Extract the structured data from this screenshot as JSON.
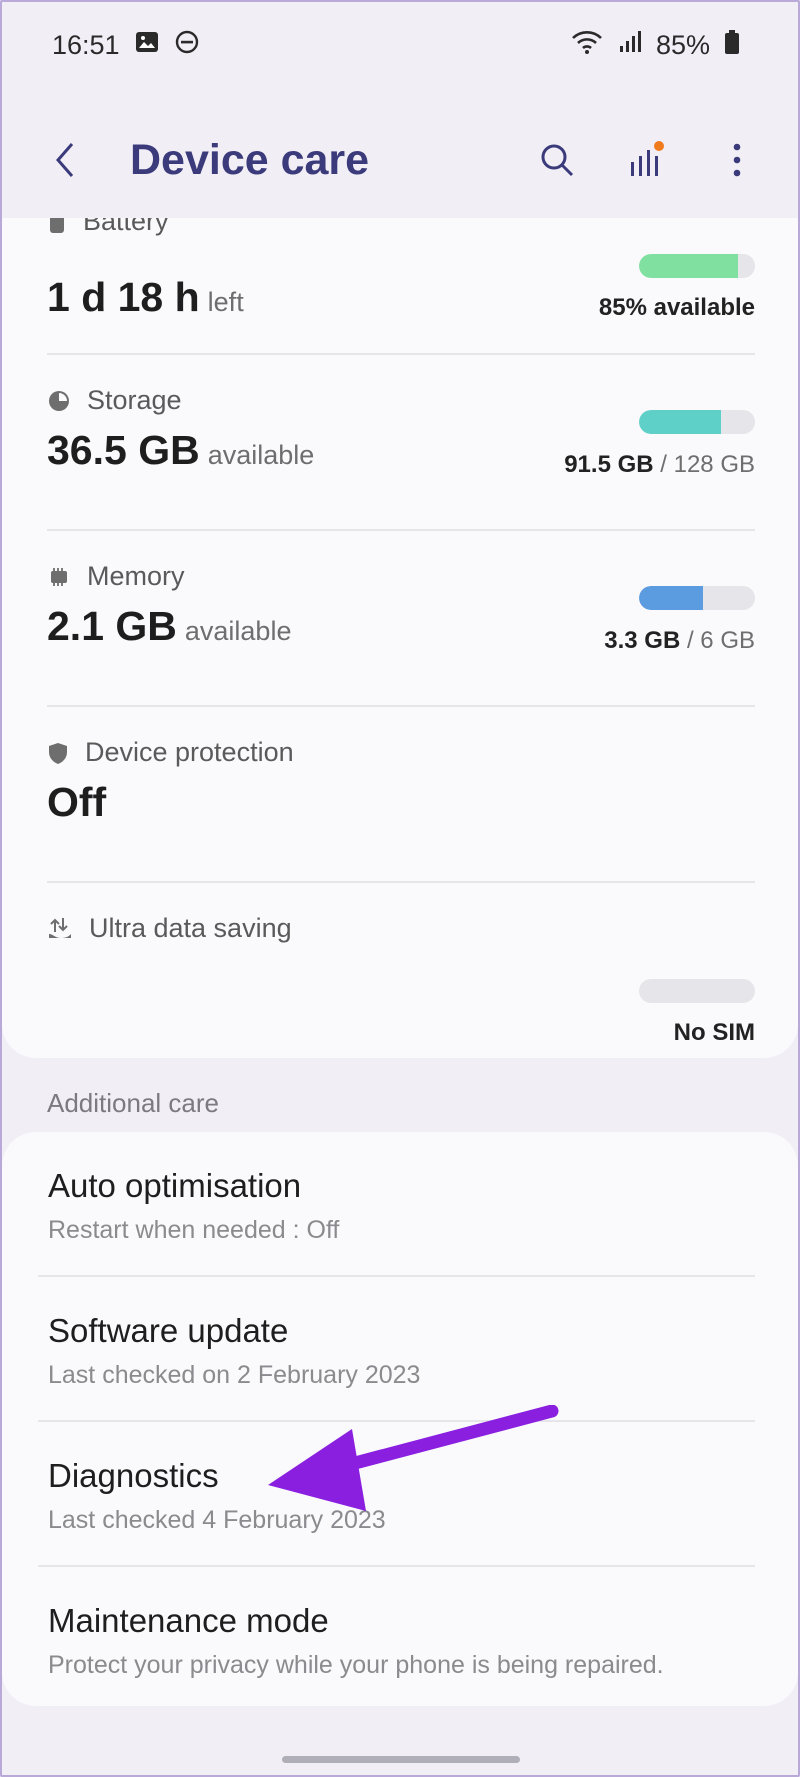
{
  "status_bar": {
    "time": "16:51",
    "battery": "85%"
  },
  "app_bar": {
    "title": "Device care"
  },
  "stats": {
    "battery": {
      "label": "Battery",
      "value": "1 d 18 h",
      "unit": "left",
      "side": "85% available",
      "fill": 0.85,
      "color": "#7fe0a0"
    },
    "storage": {
      "label": "Storage",
      "value": "36.5 GB",
      "unit": "available",
      "side_bold": "91.5 GB",
      "side_light": "/ 128 GB",
      "fill": 0.71,
      "color": "#5fd0c8"
    },
    "memory": {
      "label": "Memory",
      "value": "2.1 GB",
      "unit": "available",
      "side_bold": "3.3 GB",
      "side_light": "/ 6 GB",
      "fill": 0.55,
      "color": "#5b9be0"
    },
    "protection": {
      "label": "Device protection",
      "value": "Off"
    },
    "ultra": {
      "label": "Ultra data saving",
      "side": "No SIM",
      "fill": 0
    }
  },
  "additional": {
    "section_label": "Additional care",
    "items": [
      {
        "title": "Auto optimisation",
        "sub": "Restart when needed : Off"
      },
      {
        "title": "Software update",
        "sub": "Last checked on 2 February 2023"
      },
      {
        "title": "Diagnostics",
        "sub": "Last checked 4 February 2023"
      },
      {
        "title": "Maintenance mode",
        "sub": "Protect your privacy while your phone is being repaired."
      }
    ]
  },
  "colors": {
    "accent": "#3b3a7a",
    "annotation_arrow": "#8a1fe0",
    "badge": "#f07a1e"
  }
}
